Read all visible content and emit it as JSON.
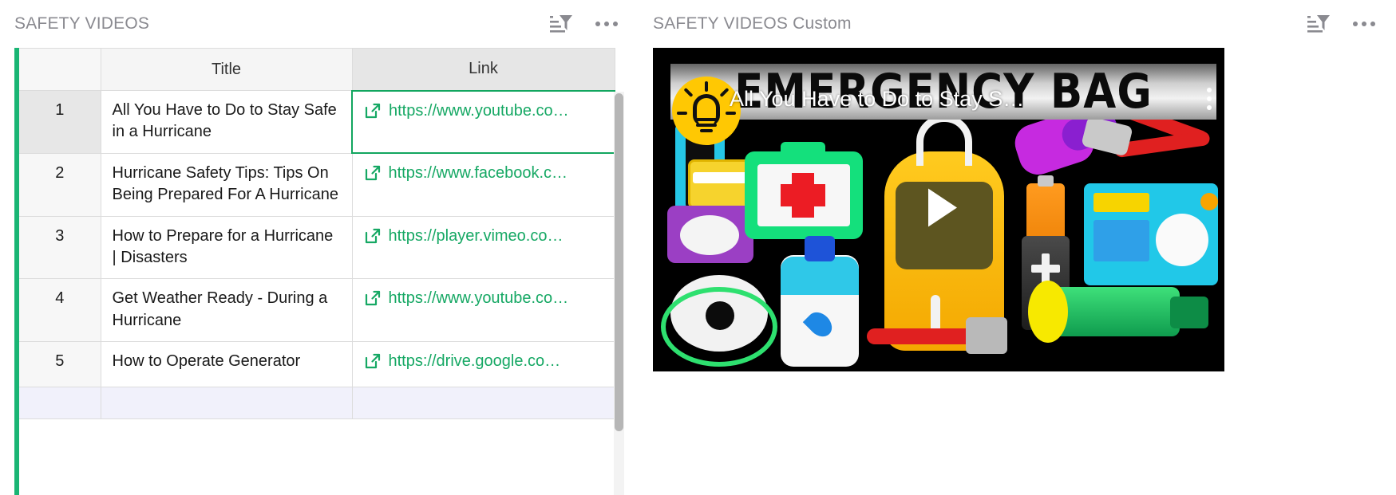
{
  "left_panel": {
    "title": "SAFETY VIDEOS",
    "filter_icon": "sort-filter-icon",
    "more_icon": "more-options-icon",
    "accent_color": "#19b574",
    "link_color": "#16a864",
    "columns": [
      "",
      "Title",
      "Link"
    ],
    "rows": [
      {
        "num": "1",
        "title": "All You Have to Do to Stay Safe in a Hurricane",
        "link": "https://www.youtube.co…"
      },
      {
        "num": "2",
        "title": "Hurricane Safety Tips: Tips On Being Prepared For A Hurricane",
        "link": "https://www.facebook.c…"
      },
      {
        "num": "3",
        "title": "How to Prepare for a Hurricane | Disasters",
        "link": "https://player.vimeo.co…"
      },
      {
        "num": "4",
        "title": "Get Weather Ready - During a Hurricane",
        "link": "https://www.youtube.co…"
      },
      {
        "num": "5",
        "title": "How to Operate Generator",
        "link": "https://drive.google.co…"
      },
      {
        "num": "",
        "title": "",
        "link": ""
      }
    ]
  },
  "right_panel": {
    "title": "SAFETY VIDEOS Custom",
    "filter_icon": "sort-filter-icon",
    "more_icon": "more-options-icon",
    "video": {
      "overlay_title": "All You Have to Do to Stay S…",
      "banner_text": "EMERGENCY BAG",
      "play_label": "play-button",
      "menu_label": "video-options-menu",
      "background_color": "#000000"
    }
  }
}
